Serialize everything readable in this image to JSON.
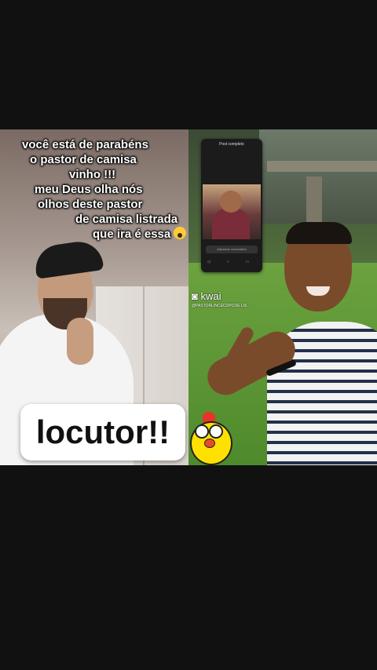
{
  "caption": {
    "lines": [
      "você está de parabéns",
      "o pastor de camisa",
      "vinho !!!",
      "meu Deus olha nós",
      "olhos deste pastor",
      "de camisa listrada",
      "que ira é essa"
    ],
    "emoji": "scream-emoji"
  },
  "badge": {
    "text": "locutor!!"
  },
  "inset_phone": {
    "title": "Post completo",
    "comment_placeholder": "Adicionar comentário",
    "nav": "◁ ○ □"
  },
  "watermark": {
    "brand": "kwai",
    "handle": "@PASTORLINCECOPCOE LIS"
  },
  "sticker": {
    "name": "scared-chick-sticker"
  }
}
